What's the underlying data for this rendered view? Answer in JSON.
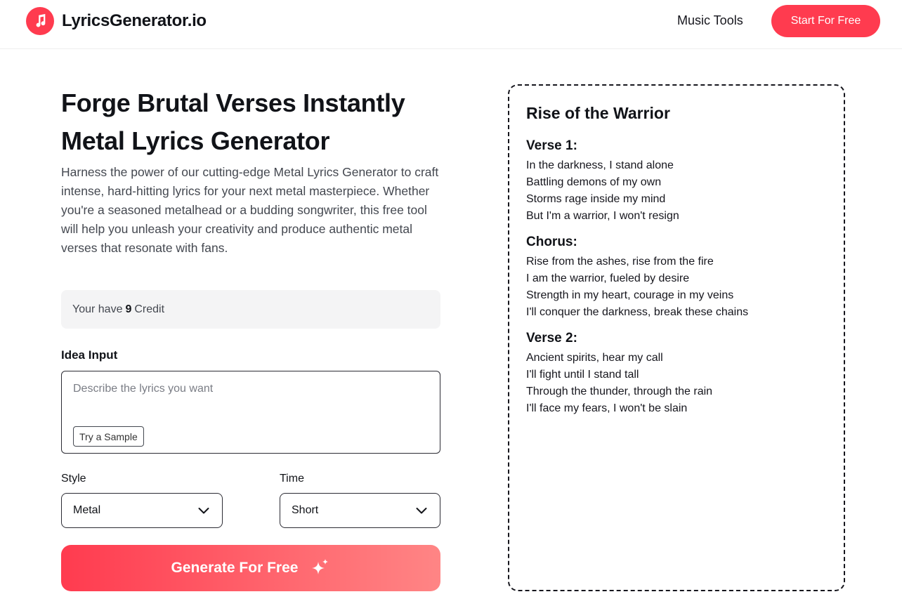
{
  "header": {
    "brand": "LyricsGenerator.io",
    "nav_link": "Music Tools",
    "cta_label": "Start For Free",
    "logo_icon": "music-note-icon",
    "accent_color": "#ff3b4f"
  },
  "main": {
    "title_line1": "Forge Brutal Verses Instantly",
    "title_line2": "Metal Lyrics Generator",
    "description": "Harness the power of our cutting-edge Metal Lyrics Generator to craft intense, hard-hitting lyrics for your next metal masterpiece. Whether you're a seasoned metalhead or a budding songwriter, this free tool will help you unleash your creativity and produce authentic metal verses that resonate with fans.",
    "credits": {
      "prefix": "Your have",
      "count": "9",
      "suffix": "Credit"
    },
    "idea_input": {
      "label": "Idea Input",
      "placeholder": "Describe the lyrics you want",
      "value": "",
      "sample_button": "Try a Sample"
    },
    "style": {
      "label": "Style",
      "selected": "Metal",
      "icon": "chevron-down-icon"
    },
    "time": {
      "label": "Time",
      "selected": "Short",
      "icon": "chevron-down-icon"
    },
    "generate_label": "Generate For Free",
    "generate_icon": "sparkle-icon"
  },
  "output": {
    "song_title": "Rise of the Warrior",
    "sections": [
      {
        "title": "Verse 1:",
        "lines": [
          "In the darkness, I stand alone",
          "Battling demons of my own",
          "Storms rage inside my mind",
          "But I'm a warrior, I won't resign"
        ]
      },
      {
        "title": "Chorus:",
        "lines": [
          "Rise from the ashes, rise from the fire",
          "I am the warrior, fueled by desire",
          "Strength in my heart, courage in my veins",
          "I'll conquer the darkness, break these chains"
        ]
      },
      {
        "title": "Verse 2:",
        "lines": [
          "Ancient spirits, hear my call",
          "I'll fight until I stand tall",
          "Through the thunder, through the rain",
          "I'll face my fears, I won't be slain"
        ]
      }
    ]
  }
}
